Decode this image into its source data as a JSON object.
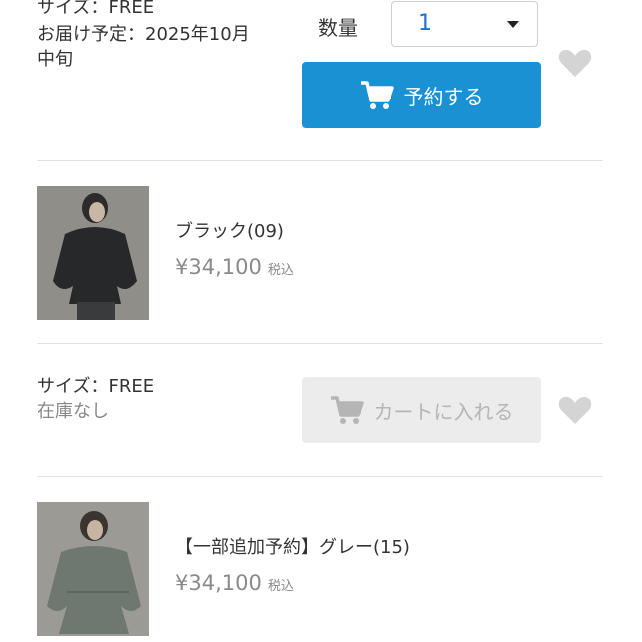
{
  "item1": {
    "size": "サイズ：FREE",
    "delivery_line1": "お届け予定：2025年10月",
    "delivery_line2": "中旬",
    "qty_label": "数量",
    "qty_value": "1",
    "reserve_label": "予約する"
  },
  "product_black": {
    "name": "ブラック(09)",
    "price": "¥34,100",
    "tax": "税込",
    "size": "サイズ：FREE",
    "stock": "在庫なし",
    "cart_label": "カートに入れる"
  },
  "product_gray": {
    "name": "【一部追加予約】グレー(15)",
    "price": "¥34,100",
    "tax": "税込"
  },
  "colors": {
    "reserve_button": "#1a91d3",
    "disabled_button": "#ececec",
    "heart": "#d4d4d4",
    "qty_value": "#1a73c8"
  },
  "icons": [
    "cart-icon",
    "heart-icon",
    "chevron-down-icon"
  ]
}
